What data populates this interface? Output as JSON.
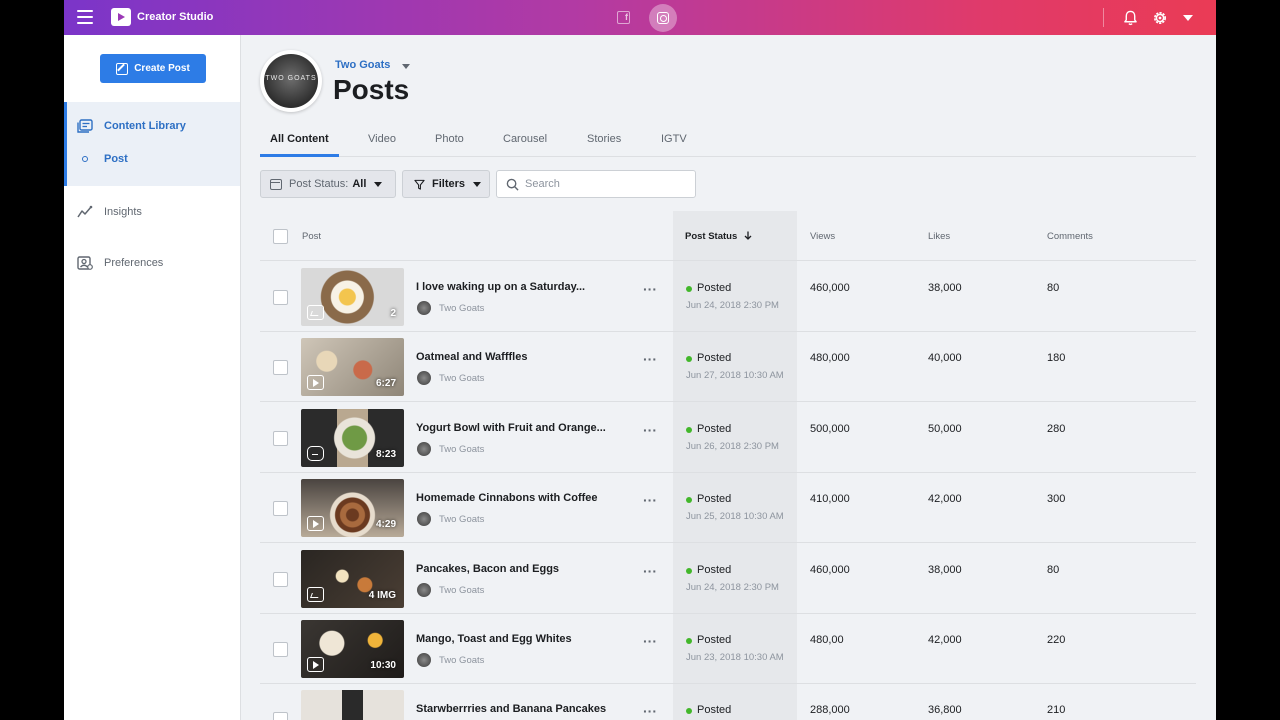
{
  "app": {
    "title": "Creator Studio",
    "colors": {
      "accent": "#2d7ce6",
      "posted": "#42b72a",
      "gradient_start": "#7b35c9",
      "gradient_end": "#ea3b55"
    }
  },
  "topbar": {
    "fb_glyph": "f",
    "icons": [
      "menu-icon",
      "creator-studio-icon",
      "facebook-icon",
      "instagram-icon",
      "bell-icon",
      "gear-icon",
      "caret-down-icon"
    ]
  },
  "sidebar": {
    "create_post": "Create Post",
    "items": [
      {
        "label": "Content Library",
        "icon": "content-library-icon",
        "active": true
      },
      {
        "label": "Post",
        "icon": "dot-icon",
        "active": true
      },
      {
        "label": "Insights",
        "icon": "insights-icon",
        "active": false
      },
      {
        "label": "Preferences",
        "icon": "preferences-icon",
        "active": false
      }
    ]
  },
  "header": {
    "avatar_text": "TWO GOATS",
    "account_name": "Two Goats",
    "title": "Posts"
  },
  "tabs": [
    "All Content",
    "Video",
    "Photo",
    "Carousel",
    "Stories",
    "IGTV"
  ],
  "toolbar": {
    "status_label": "Post Status:",
    "status_value": "All",
    "filters_label": "Filters",
    "search_placeholder": "Search"
  },
  "table": {
    "columns": [
      "Post",
      "Post Status",
      "Views",
      "Likes",
      "Comments"
    ],
    "rows": [
      {
        "title": "I love waking up on a Saturday...",
        "author": "Two Goats",
        "status": "Posted",
        "date": "Jun 24, 2018 2:30 PM",
        "views": "460,000",
        "likes": "38,000",
        "comments": "80",
        "media": "photo",
        "badge": "2"
      },
      {
        "title": "Oatmeal and Wafffles",
        "author": "Two Goats",
        "status": "Posted",
        "date": "Jun 27, 2018 10:30 AM",
        "views": "480,000",
        "likes": "40,000",
        "comments": "180",
        "media": "video",
        "badge": "6:27"
      },
      {
        "title": "Yogurt Bowl with Fruit and Orange...",
        "author": "Two Goats",
        "status": "Posted",
        "date": "Jun 26, 2018 2:30 PM",
        "views": "500,000",
        "likes": "50,000",
        "comments": "280",
        "media": "igtv",
        "badge": "8:23"
      },
      {
        "title": "Homemade Cinnabons with Coffee",
        "author": "Two Goats",
        "status": "Posted",
        "date": "Jun 25, 2018 10:30 AM",
        "views": "410,000",
        "likes": "42,000",
        "comments": "300",
        "media": "video",
        "badge": "4:29"
      },
      {
        "title": "Pancakes, Bacon and Eggs",
        "author": "Two Goats",
        "status": "Posted",
        "date": "Jun 24, 2018 2:30 PM",
        "views": "460,000",
        "likes": "38,000",
        "comments": "80",
        "media": "photo",
        "badge": "4 IMG"
      },
      {
        "title": "Mango, Toast and Egg Whites",
        "author": "Two Goats",
        "status": "Posted",
        "date": "Jun 23, 2018 10:30 AM",
        "views": "480,00",
        "likes": "42,000",
        "comments": "220",
        "media": "video",
        "badge": "10:30"
      },
      {
        "title": "Starwberrries and Banana Pancakes",
        "author": "Two Goats",
        "status": "Posted",
        "date": "",
        "views": "288,000",
        "likes": "36,800",
        "comments": "210",
        "media": "photo",
        "badge": ""
      }
    ]
  }
}
